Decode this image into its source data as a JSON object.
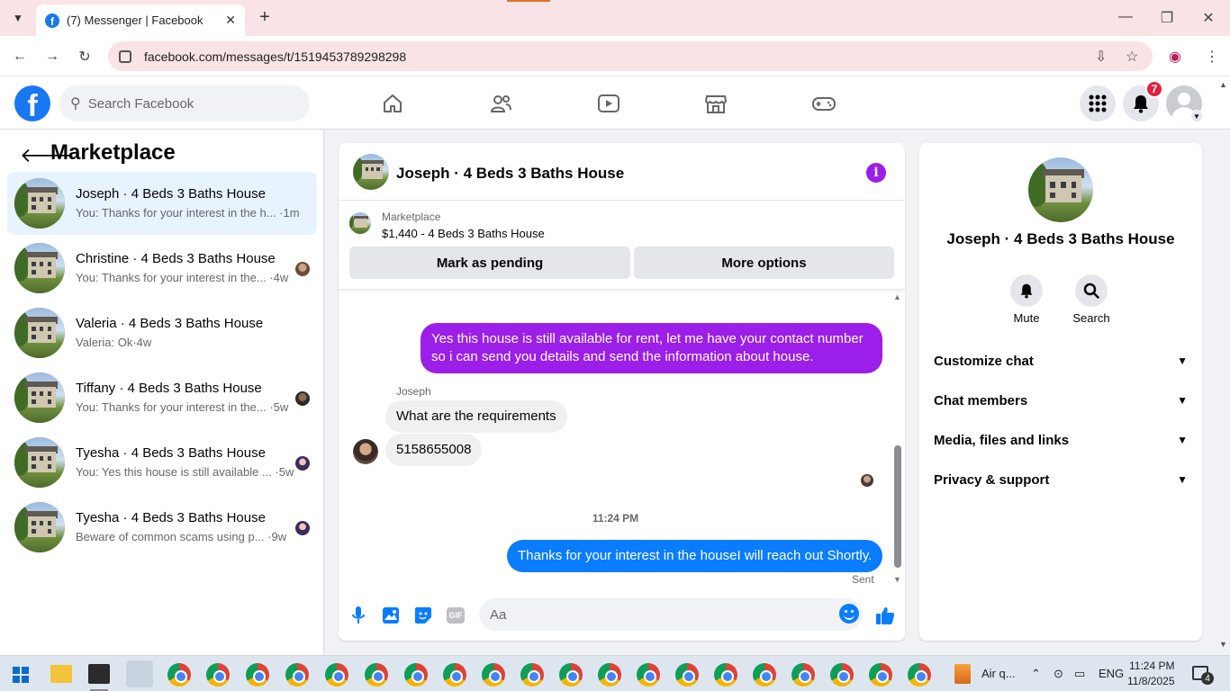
{
  "browser": {
    "tab_title": "(7) Messenger | Facebook",
    "url": "facebook.com/messages/t/1519453789298298",
    "new_tab_label": "+",
    "close_label": "✕"
  },
  "fb_header": {
    "search_placeholder": "Search Facebook",
    "notification_count": "7"
  },
  "left_pane": {
    "title": "Marketplace",
    "conversations": [
      {
        "name": "Joseph · 4 Beds 3 Baths House",
        "preview": "You: Thanks for your interest in the h... ·1m",
        "active": true
      },
      {
        "name": "Christine · 4 Beds 3 Baths House",
        "preview": "You: Thanks for your interest in the... ·4w",
        "active": false
      },
      {
        "name": "Valeria · 4 Beds 3 Baths House",
        "preview": "Valeria: Ok·4w",
        "active": false
      },
      {
        "name": "Tiffany · 4 Beds 3 Baths House",
        "preview": "You: Thanks for your interest in the... ·5w",
        "active": false
      },
      {
        "name": "Tyesha · 4 Beds 3 Baths House",
        "preview": "You: Yes this house is still available ... ·5w",
        "active": false
      },
      {
        "name": "Tyesha · 4 Beds 3 Baths House",
        "preview": "Beware of common scams using p... ·9w",
        "active": false
      }
    ]
  },
  "chat": {
    "title": "Joseph · 4 Beds 3 Baths House",
    "listing_label": "Marketplace",
    "listing_price": "$1,440 - 4 Beds 3 Baths House",
    "mark_pending_label": "Mark as pending",
    "more_options_label": "More options",
    "messages": {
      "outgoing_1": "Yes this house is still available for rent, let me have your contact number so i can send you details and send the information about house.",
      "sender_name": "Joseph",
      "incoming_1": "What are the requirements",
      "incoming_2": "5158655008",
      "timestamp": "11:24 PM",
      "outgoing_2": "Thanks for your interest in the houseI will reach out Shortly.",
      "status": "Sent"
    },
    "composer_placeholder": "Aa",
    "gif_label": "GIF"
  },
  "info_pane": {
    "name": "Joseph · 4 Beds 3 Baths House",
    "mute_label": "Mute",
    "search_label": "Search",
    "sections": [
      "Customize chat",
      "Chat members",
      "Media, files and links",
      "Privacy & support"
    ]
  },
  "taskbar": {
    "weather": "Air q...",
    "language": "ENG",
    "time": "11:24 PM",
    "date": "11/8/2025",
    "notification_count": "4"
  },
  "colors": {
    "fb_blue": "#1877f2",
    "outgoing_purple": "#9b1fe8",
    "outgoing_blue": "#0a7cff",
    "active_row": "#e7f3ff"
  }
}
